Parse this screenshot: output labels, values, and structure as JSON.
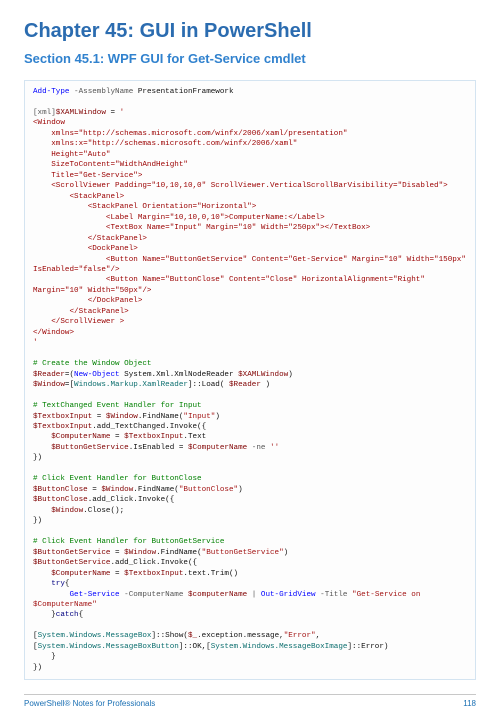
{
  "chapter_title": "Chapter 45: GUI in PowerShell",
  "section_title": "Section 45.1: WPF GUI for Get-Service cmdlet",
  "code": {
    "l01a": "Add-Type",
    "l01b": " -AssemblyName",
    "l01c": " PresentationFramework",
    "l02": "",
    "l03a": "[xml]",
    "l03b": "$XAMLWindow",
    "l03c": " = ",
    "l03d": "'",
    "l04": "<Window",
    "l05": "    xmlns=\"http://schemas.microsoft.com/winfx/2006/xaml/presentation\"",
    "l06": "    xmlns:x=\"http://schemas.microsoft.com/winfx/2006/xaml\"",
    "l07": "    Height=\"Auto\"",
    "l08": "    SizeToContent=\"WidthAndHeight\"",
    "l09": "    Title=\"Get-Service\">",
    "l10": "    <ScrollViewer Padding=\"10,10,10,0\" ScrollViewer.VerticalScrollBarVisibility=\"Disabled\">",
    "l11": "        <StackPanel>",
    "l12": "            <StackPanel Orientation=\"Horizontal\">",
    "l13": "                <Label Margin=\"10,10,0,10\">ComputerName:</Label>",
    "l14": "                <TextBox Name=\"Input\" Margin=\"10\" Width=\"250px\"></TextBox>",
    "l15": "            </StackPanel>",
    "l16": "            <DockPanel>",
    "l17": "                <Button Name=\"ButtonGetService\" Content=\"Get-Service\" Margin=\"10\" Width=\"150px\" IsEnabled=\"false\"/>",
    "l18": "                <Button Name=\"ButtonClose\" Content=\"Close\" HorizontalAlignment=\"Right\" Margin=\"10\" Width=\"50px\"/>",
    "l19": "            </DockPanel>",
    "l20": "        </StackPanel>",
    "l21": "    </ScrollViewer >",
    "l22": "</Window>",
    "l23": "'",
    "l24": "",
    "c1": "# Create the Window Object",
    "r1a": "$Reader",
    "r1b": "=(",
    "r1c": "New-Object",
    "r1d": " System.Xml.XmlNodeReader ",
    "r1e": "$XAMLWindow",
    "r1f": ")",
    "w1a": "$Window",
    "w1b": "=[",
    "w1c": "Windows.Markup.XamlReader",
    "w1d": "]::Load( ",
    "w1e": "$Reader",
    "w1f": " )",
    "c2": "# TextChanged Event Handler for Input",
    "t1a": "$TextboxInput",
    "t1b": " = ",
    "t1c": "$Window",
    "t1d": ".FindName(",
    "t1e": "\"Input\"",
    "t1f": ")",
    "t2a": "$TextboxInput",
    "t2b": ".add_TextChanged.Invoke({",
    "t3a": "    $ComputerName",
    "t3b": " = ",
    "t3c": "$TextboxInput",
    "t3d": ".Text",
    "t4a": "    $ButtonGetService",
    "t4b": ".IsEnabled = ",
    "t4c": "$ComputerName",
    "t4d": " -ne ",
    "t4e": "''",
    "t5": "})",
    "c3": "# Click Event Handler for ButtonClose",
    "b1a": "$ButtonClose",
    "b1b": " = ",
    "b1c": "$Window",
    "b1d": ".FindName(",
    "b1e": "\"ButtonClose\"",
    "b1f": ")",
    "b2a": "$ButtonClose",
    "b2b": ".add_Click.Invoke({",
    "b3a": "    $Window",
    "b3b": ".Close();",
    "b4": "})",
    "c4": "# Click Event Handler for ButtonGetService",
    "g1a": "$ButtonGetService",
    "g1b": " = ",
    "g1c": "$Window",
    "g1d": ".FindName(",
    "g1e": "\"ButtonGetService\"",
    "g1f": ")",
    "g2a": "$ButtonGetService",
    "g2b": ".add_Click.Invoke({",
    "g3a": "    $ComputerName",
    "g3b": " = ",
    "g3c": "$TextboxInput",
    "g3d": ".text.Trim()",
    "g4a": "    try",
    "g4b": "{",
    "g5a": "        Get-Service",
    "g5b": " -ComputerName ",
    "g5c": "$computerName",
    "g5d": " | ",
    "g5e": "Out-GridView",
    "g5f": " -Title ",
    "g5g": "\"Get-Service on $ComputerName\"",
    "g6a": "    }",
    "g6b": "catch",
    "g6c": "{",
    "m1a": "[",
    "m1b": "System.Windows.MessageBox",
    "m1c": "]::Show(",
    "m1d": "$_",
    "m1e": ".exception.message,",
    "m1f": "\"Error\"",
    "m1g": ",[",
    "m1h": "System.Windows.MessageBoxButton",
    "m1i": "]::OK,[",
    "m1j": "System.Windows.MessageBoxImage",
    "m1k": "]::Error)",
    "m2": "    }",
    "m3": "})"
  },
  "footer_left": "PowerShell® Notes for Professionals",
  "footer_right": "118"
}
